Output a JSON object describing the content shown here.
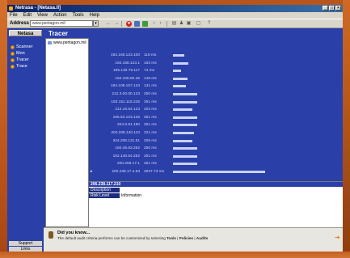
{
  "window": {
    "title": "Netrasa - [Netasa.ll]"
  },
  "menu": [
    "File",
    "Edit",
    "View",
    "Action",
    "Tools",
    "Help"
  ],
  "toolbar": {
    "address_label": "Address",
    "address_value": "www.pentagon.mil"
  },
  "sidebar": {
    "heading": "Netasa",
    "items": [
      {
        "label": "Scanner",
        "icon": "circle-icon"
      },
      {
        "label": "Mon",
        "icon": "circle-icon"
      },
      {
        "label": "Tracer",
        "icon": "circle-icon"
      },
      {
        "label": "Trace",
        "icon": "circle-icon"
      }
    ],
    "support_label": "Support",
    "links_label": "Links"
  },
  "content": {
    "title": "Tracer",
    "tree_item": "www.pentagon.mil"
  },
  "chart_data": {
    "type": "bar",
    "categories": [
      "192.168.123.100",
      "192.168.123.1",
      "195.130.79.117",
      "194.108.50.25",
      "194.108.167.134",
      "212.3.00.00.123",
      "193.151.115.226",
      "212.16.54.123",
      "195.53.123.126",
      "204.6.81.190",
      "204.208.140.110",
      "204.208.131.51",
      "160.46.63.252",
      "192.148.54.252",
      "200.208.17.1",
      "200.238.17.4.63"
    ],
    "labels": [
      "116 ms",
      "163 ms",
      "74 ms",
      "148 ms",
      "131 ms",
      "250 ms",
      "251 ms",
      "203 ms",
      "251 ms",
      "251 ms",
      "221 ms",
      "205 ms",
      "250 ms",
      "251 ms",
      "251 ms",
      "2937.73 ms"
    ],
    "values": [
      116,
      163,
      74,
      148,
      131,
      250,
      251,
      203,
      251,
      251,
      221,
      205,
      250,
      251,
      251,
      2937
    ],
    "xlabel": "",
    "ylabel": "",
    "ylim": [
      0,
      2937
    ],
    "accent_color": "#c8d2ff"
  },
  "details": {
    "host": "206.238.117.210",
    "rows": [
      {
        "key": "Description",
        "value": ""
      },
      {
        "key": "Risk Level",
        "value": "Information"
      }
    ]
  },
  "tip": {
    "title": "Did you know...",
    "text_prefix": "The default audit criteria performs can be customized by selecting",
    "link1": "Tools",
    "link2": "Policies",
    "link3": "Audits"
  }
}
